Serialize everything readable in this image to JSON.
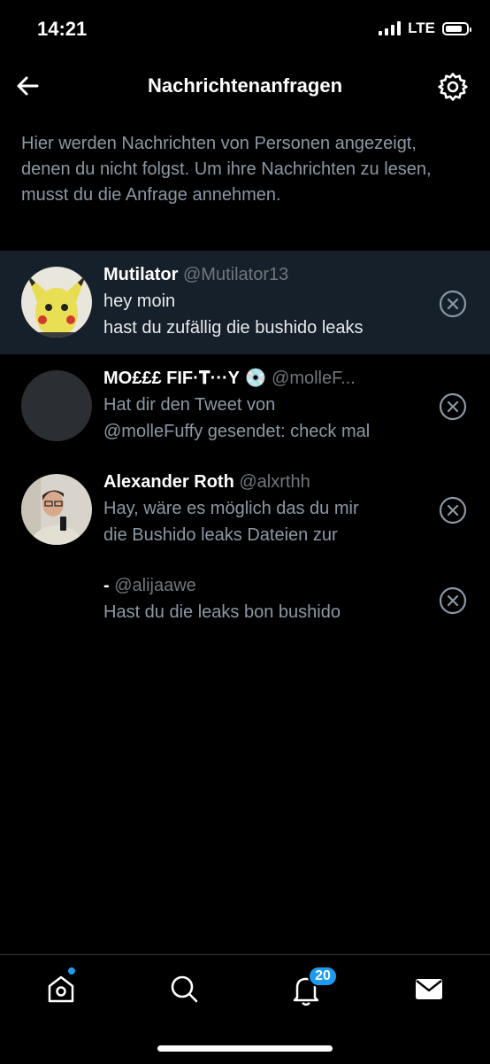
{
  "status_bar": {
    "time": "14:21",
    "network": "LTE"
  },
  "header": {
    "title": "Nachrichtenanfragen"
  },
  "info_text": "Hier werden Nachrichten von Personen angezeigt, denen du nicht folgst. Um ihre Nachrichten zu lesen, musst du die Anfrage annehmen.",
  "conversations": [
    {
      "name": "Mutilator",
      "handle": "@Mutilator13",
      "line_a": "hey moin",
      "line_b": "hast du zufällig die bushido leaks"
    },
    {
      "name": "MO£££ FIF·𝐓···Y",
      "emoji": "💿",
      "handle": "@molleF...",
      "line_a": "Hat dir den Tweet von",
      "line_b": "@molleFuffy gesendet: check mal"
    },
    {
      "name": "Alexander Roth",
      "handle": "@alxrthh",
      "line_a": "Hay, wäre es möglich das du mir",
      "line_b": "die Bushido leaks Dateien zur"
    },
    {
      "name": "-",
      "handle": "@alijaawe",
      "line_a": "Hast du die leaks bon bushido"
    }
  ],
  "tabbar": {
    "notifications_count": "20"
  },
  "colors": {
    "accent": "#1d9bf0",
    "highlight_row": "#16202a",
    "background": "#000000"
  }
}
